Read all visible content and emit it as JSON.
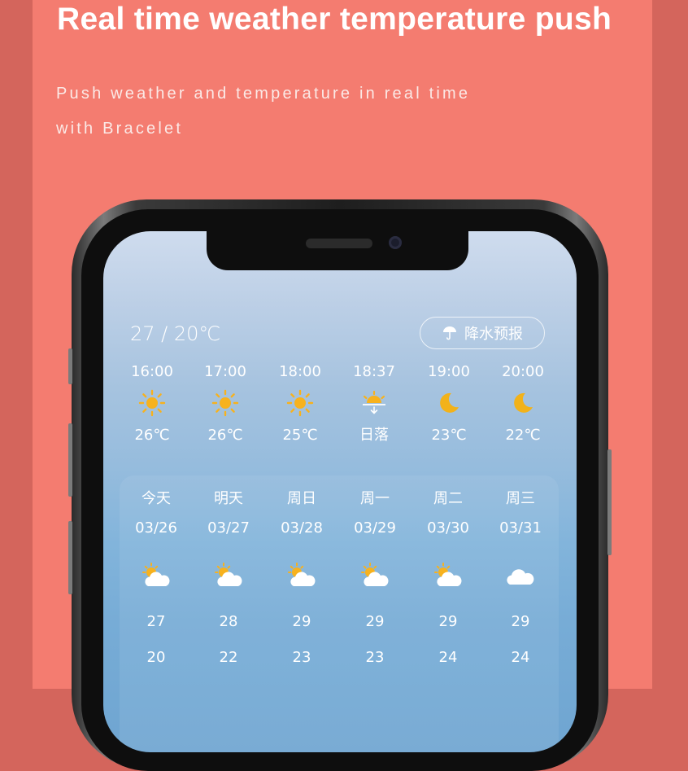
{
  "banner": {
    "title": "Real time weather temperature push",
    "subtitle_line1": "Push weather and temperature in real time",
    "subtitle_line2": "with Bracelet"
  },
  "weather": {
    "temp_range": "27 / 20℃",
    "rain_button_label": "降水预报",
    "rain_button_icon": "umbrella-icon",
    "hourly": [
      {
        "time": "16:00",
        "icon": "sun-icon",
        "value": "26℃"
      },
      {
        "time": "17:00",
        "icon": "sun-icon",
        "value": "26℃"
      },
      {
        "time": "18:00",
        "icon": "sun-icon",
        "value": "25℃"
      },
      {
        "time": "18:37",
        "icon": "sunset-icon",
        "value": "日落"
      },
      {
        "time": "19:00",
        "icon": "moon-icon",
        "value": "23℃"
      },
      {
        "time": "20:00",
        "icon": "moon-icon",
        "value": "22℃"
      }
    ],
    "daily": [
      {
        "day": "今天",
        "date": "03/26",
        "icon": "partly-cloudy-icon",
        "high": "27",
        "low": "20"
      },
      {
        "day": "明天",
        "date": "03/27",
        "icon": "partly-cloudy-icon",
        "high": "28",
        "low": "22"
      },
      {
        "day": "周日",
        "date": "03/28",
        "icon": "partly-cloudy-icon",
        "high": "29",
        "low": "23"
      },
      {
        "day": "周一",
        "date": "03/29",
        "icon": "partly-cloudy-icon",
        "high": "29",
        "low": "23"
      },
      {
        "day": "周二",
        "date": "03/30",
        "icon": "partly-cloudy-icon",
        "high": "29",
        "low": "24"
      },
      {
        "day": "周三",
        "date": "03/31",
        "icon": "cloud-icon",
        "high": "29",
        "low": "24"
      }
    ]
  },
  "colors": {
    "background": "#f47c70",
    "side_bands": "#d4655c",
    "sun": "#f7b21e",
    "moon": "#f2b21a"
  }
}
